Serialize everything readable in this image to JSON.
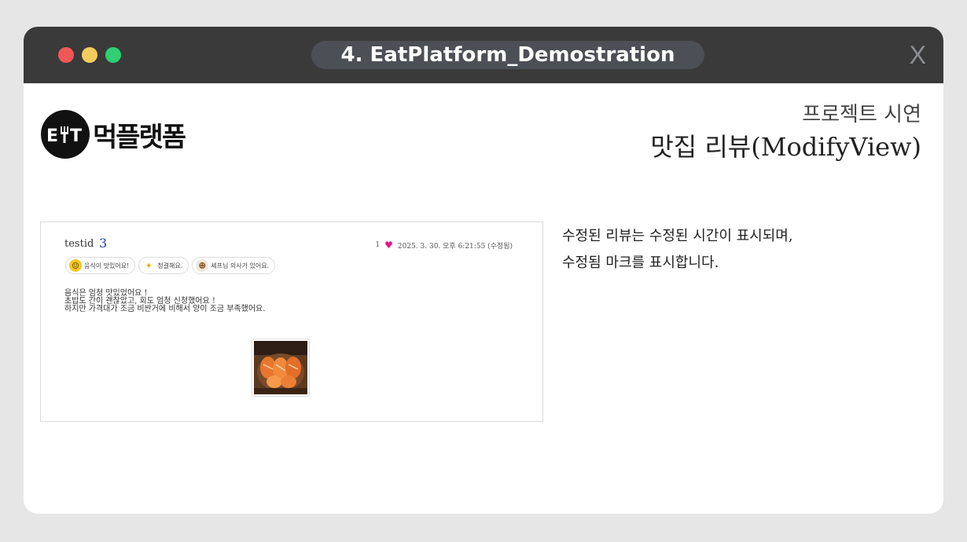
{
  "window": {
    "title": "4. EatPlatform_Demostration",
    "close_label": "X"
  },
  "logo": {
    "mark": "EꝊT",
    "text": "먹플랫폼"
  },
  "heading": {
    "sub": "프로젝트 시연",
    "main": "맛집 리뷰(ModifyView)"
  },
  "review": {
    "user": "testid",
    "rating": "3",
    "likes": "1",
    "timestamp": "2025. 3. 30. 오후 6:21:55 (수정됨)",
    "tags": [
      {
        "label": "음식이 맛있어요!",
        "icon": "smile-icon"
      },
      {
        "label": "청결해요.",
        "icon": "sparkle-icon"
      },
      {
        "label": "셰프님 의사가 있어요.",
        "icon": "chef-icon"
      }
    ],
    "body_lines": [
      "음식은 엄청 맛있었어요 !",
      "초밥도 간이 괜찮았고, 회도 엄청 신청했어요 !",
      "하지만 가격대가 조금 비싼거에 비해서 양이 조금 부족했어요."
    ]
  },
  "description": {
    "line1": "수정된 리뷰는 수정된 시간이 표시되며,",
    "line2": "수정됨 마크를 표시합니다."
  },
  "colors": {
    "titlebar": "#3a3a3a",
    "traffic_red": "#f25757",
    "traffic_yellow": "#f2cc5c",
    "traffic_green": "#2fcf72",
    "rating_blue": "#1a43b8",
    "heart_pink": "#e0148a"
  }
}
